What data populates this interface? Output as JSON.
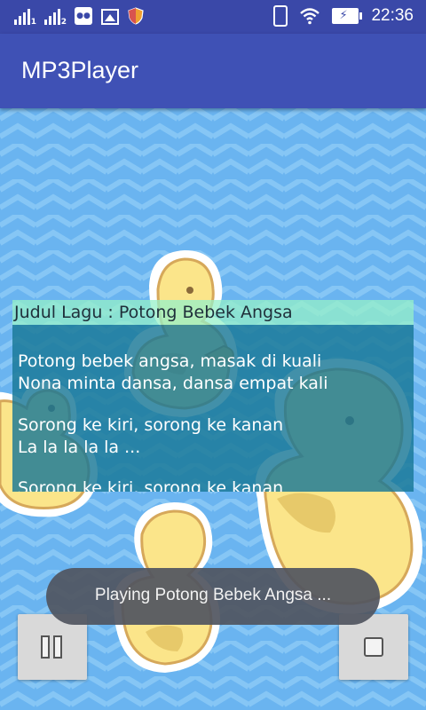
{
  "status_bar": {
    "time": "22:36",
    "sim1_label": "1",
    "sim2_label": "2",
    "icons": [
      "signal-icon",
      "signal-icon",
      "bbm-icon",
      "image-icon",
      "shield-icon",
      "vibrate-icon",
      "wifi-icon",
      "battery-charging-icon"
    ]
  },
  "app_bar": {
    "title": "MP3Player"
  },
  "song": {
    "title": "Judul Lagu : Potong Bebek Angsa",
    "lyrics": [
      "Potong bebek angsa, masak di kuali",
      "Nona minta dansa, dansa empat kali",
      "",
      "Sorong ke kiri, sorong ke kanan",
      "La la la la la ...",
      "",
      "Sorong ke kiri, sorong ke kanan"
    ]
  },
  "toast": {
    "message": "Playing Potong Bebek Angsa ..."
  },
  "controls": {
    "pause_icon": "pause-icon",
    "stop_icon": "stop-icon"
  },
  "colors": {
    "status_bar": "#3a48a8",
    "app_bar": "#3f51b5",
    "background": "#6ab4f0",
    "duck_yellow": "#fbe58a",
    "duck_outline": "#d6a85a",
    "beak": "#f5c24a"
  }
}
